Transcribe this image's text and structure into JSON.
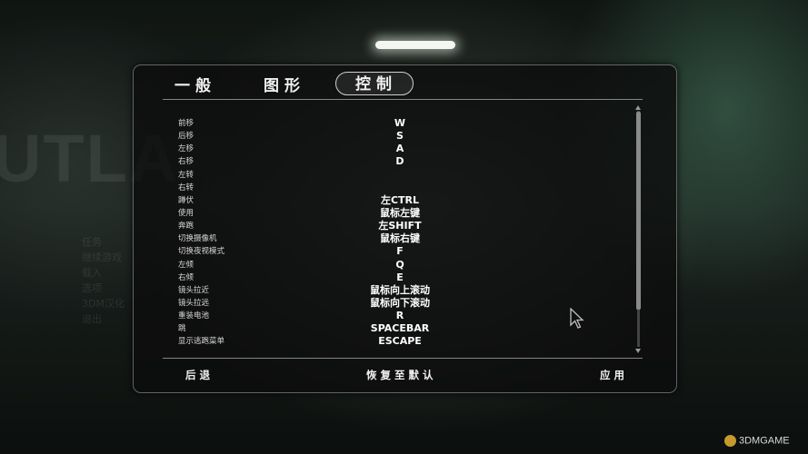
{
  "tabs": [
    {
      "label": "一般",
      "active": false
    },
    {
      "label": "图形",
      "active": false
    },
    {
      "label": "控制",
      "active": true
    }
  ],
  "bindings": [
    {
      "action": "前移",
      "key": "W"
    },
    {
      "action": "后移",
      "key": "S"
    },
    {
      "action": "左移",
      "key": "A"
    },
    {
      "action": "右移",
      "key": "D"
    },
    {
      "action": "左转",
      "key": ""
    },
    {
      "action": "右转",
      "key": ""
    },
    {
      "action": "蹲伏",
      "key": "左CTRL"
    },
    {
      "action": "使用",
      "key": "鼠标左键"
    },
    {
      "action": "奔跑",
      "key": "左SHIFT"
    },
    {
      "action": "切换摄像机",
      "key": "鼠标右键"
    },
    {
      "action": "切换夜视模式",
      "key": "F"
    },
    {
      "action": "左倾",
      "key": "Q"
    },
    {
      "action": "右倾",
      "key": "E"
    },
    {
      "action": "镜头拉近",
      "key": "鼠标向上滚动"
    },
    {
      "action": "镜头拉远",
      "key": "鼠标向下滚动"
    },
    {
      "action": "重装电池",
      "key": "R"
    },
    {
      "action": "跳",
      "key": "SPACEBAR"
    },
    {
      "action": "显示逃跑菜单",
      "key": "ESCAPE"
    }
  ],
  "footer": {
    "back": "后退",
    "restore_defaults": "恢复至默认",
    "apply": "应用"
  },
  "background": {
    "game_logo_partial": "UTLA",
    "menu_items_faint": [
      "任务",
      "继续游戏",
      "载入",
      "选项",
      "3DM汉化",
      "退出"
    ]
  },
  "watermark": "3DMGAME",
  "colors": {
    "panel_bg": "#0c0c0c",
    "text": "#ffffff",
    "accent_glow": "#466e5f"
  }
}
